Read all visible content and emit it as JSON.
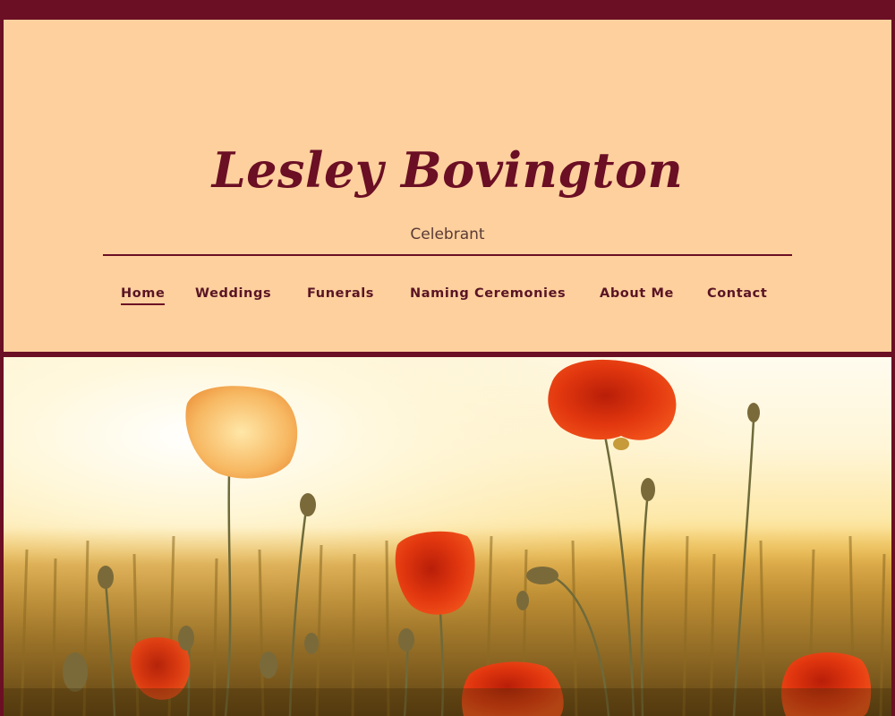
{
  "site": {
    "title": "Lesley Bovington",
    "subtitle": "Celebrant"
  },
  "nav": {
    "items": [
      {
        "label": "Home",
        "active": true
      },
      {
        "label": "Weddings",
        "active": false
      },
      {
        "label": "Funerals",
        "active": false
      },
      {
        "label": "Naming Ceremonies",
        "active": false
      },
      {
        "label": "About Me",
        "active": false
      },
      {
        "label": "Contact",
        "active": false
      }
    ]
  },
  "colors": {
    "frame": "#6b0f24",
    "header_background": "#fdd09e",
    "title_text": "#6b0f24",
    "nav_text": "#5a1424",
    "poppy_red": "#e03010"
  },
  "hero": {
    "image_subject": "poppies-in-sunlit-wheat-field"
  }
}
